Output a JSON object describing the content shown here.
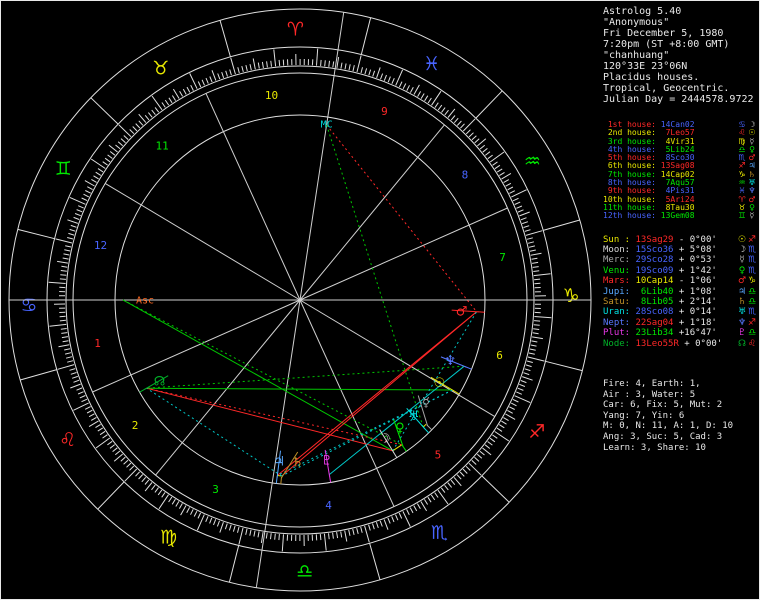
{
  "header": {
    "lines": [
      "Astrolog 5.40",
      "\"Anonymous\"",
      "Fri December 5, 1980",
      "7:20pm (ST +8:00 GMT)",
      "\"chanhuang\"",
      "120°33E 23°06N",
      "Placidus houses.",
      "Tropical, Geocentric.",
      "Julian Day = 2444578.9722"
    ]
  },
  "houses": [
    {
      "label": " 1st house: ",
      "value": "14Can02",
      "lon": 104.033,
      "sign_elem": "water",
      "sign_glyph": "♋",
      "ruler": "moon",
      "ruler_glyph": "☽"
    },
    {
      "label": " 2nd house: ",
      "value": " 7Leo57",
      "lon": 127.95,
      "sign_elem": "fire",
      "sign_glyph": "♌",
      "ruler": "sun",
      "ruler_glyph": "☉"
    },
    {
      "label": " 3rd house: ",
      "value": " 4Vir31",
      "lon": 154.517,
      "sign_elem": "earth",
      "sign_glyph": "♍",
      "ruler": "merc",
      "ruler_glyph": "☿"
    },
    {
      "label": " 4th house: ",
      "value": " 5Lib24",
      "lon": 185.4,
      "sign_elem": "air",
      "sign_glyph": "♎",
      "ruler": "venu",
      "ruler_glyph": "♀"
    },
    {
      "label": " 5th house: ",
      "value": " 8Sco30",
      "lon": 218.5,
      "sign_elem": "water",
      "sign_glyph": "♏",
      "ruler": "mars",
      "ruler_glyph": "♂"
    },
    {
      "label": " 6th house: ",
      "value": "13Sag08",
      "lon": 253.133,
      "sign_elem": "fire",
      "sign_glyph": "♐",
      "ruler": "jupi",
      "ruler_glyph": "♃"
    },
    {
      "label": " 7th house: ",
      "value": "14Cap02",
      "lon": 284.033,
      "sign_elem": "earth",
      "sign_glyph": "♑",
      "ruler": "satu",
      "ruler_glyph": "♄"
    },
    {
      "label": " 8th house: ",
      "value": " 7Aqu57",
      "lon": 307.95,
      "sign_elem": "air",
      "sign_glyph": "♒",
      "ruler": "uran",
      "ruler_glyph": "♅"
    },
    {
      "label": " 9th house: ",
      "value": " 4Pis31",
      "lon": 334.517,
      "sign_elem": "water",
      "sign_glyph": "♓",
      "ruler": "nept",
      "ruler_glyph": "♆"
    },
    {
      "label": "10th house: ",
      "value": " 5Ari24",
      "lon": 5.4,
      "sign_elem": "fire",
      "sign_glyph": "♈",
      "ruler": "mars",
      "ruler_glyph": "♂"
    },
    {
      "label": "11th house: ",
      "value": " 8Tau30",
      "lon": 38.5,
      "sign_elem": "earth",
      "sign_glyph": "♉",
      "ruler": "venu",
      "ruler_glyph": "♀"
    },
    {
      "label": "12th house: ",
      "value": "13Gem08",
      "lon": 73.133,
      "sign_elem": "air",
      "sign_glyph": "♊",
      "ruler": "merc",
      "ruler_glyph": "☿"
    }
  ],
  "planets": [
    {
      "id": "sun",
      "label": "Sun : ",
      "value": "13Sag29",
      "lat": "- 0°00'",
      "lon": 253.483,
      "sign_elem": "fire",
      "glyph": "☉",
      "sign_glyph": "♐"
    },
    {
      "id": "moon",
      "label": "Moon: ",
      "value": "15Sco36",
      "lat": "+ 5°08'",
      "lon": 225.6,
      "sign_elem": "water",
      "glyph": "☽",
      "sign_glyph": "♏"
    },
    {
      "id": "merc",
      "label": "Merc: ",
      "value": "29Sco28",
      "lat": "+ 0°53'",
      "lon": 239.467,
      "sign_elem": "water",
      "glyph": "☿",
      "sign_glyph": "♏"
    },
    {
      "id": "venu",
      "label": "Venu: ",
      "value": "19Sco09",
      "lat": "+ 1°42'",
      "lon": 229.15,
      "sign_elem": "water",
      "glyph": "♀",
      "sign_glyph": "♏"
    },
    {
      "id": "mars",
      "label": "Mars: ",
      "value": "10Cap14",
      "lat": "- 1°06'",
      "lon": 280.233,
      "sign_elem": "earth",
      "glyph": "♂",
      "sign_glyph": "♑"
    },
    {
      "id": "jupi",
      "label": "Jupi: ",
      "value": " 6Lib40",
      "lat": "+ 1°08'",
      "lon": 186.667,
      "sign_elem": "air",
      "glyph": "♃",
      "sign_glyph": "♎"
    },
    {
      "id": "satu",
      "label": "Satu: ",
      "value": " 8Lib05",
      "lat": "+ 2°14'",
      "lon": 188.083,
      "sign_elem": "air",
      "glyph": "♄",
      "sign_glyph": "♎"
    },
    {
      "id": "uran",
      "label": "Uran: ",
      "value": "28Sco08",
      "lat": "+ 0°14'",
      "lon": 238.133,
      "sign_elem": "water",
      "glyph": "♅",
      "sign_glyph": "♏"
    },
    {
      "id": "nept",
      "label": "Nept: ",
      "value": "22Sag04",
      "lat": "+ 1°18'",
      "lon": 262.067,
      "sign_elem": "fire",
      "glyph": "♆",
      "sign_glyph": "♐"
    },
    {
      "id": "plut",
      "label": "Plut: ",
      "value": "23Lib34",
      "lat": "+16°47'",
      "lon": 203.567,
      "sign_elem": "air",
      "glyph": "♇",
      "sign_glyph": "♎"
    },
    {
      "id": "node",
      "label": "Node: ",
      "value": "13Leo55R",
      "lat": "+ 0°00'",
      "lon": 133.917,
      "sign_elem": "fire",
      "glyph": "☊",
      "sign_glyph": "♌"
    }
  ],
  "stats": {
    "lines": [
      "Fire: 4, Earth: 1,",
      "Air : 3, Water: 5",
      "Car: 6, Fix: 5, Mut: 2",
      "Yang: 7, Yin: 6",
      "M: 0, N: 11, A: 1, D: 10",
      "Ang: 3, Suc: 5, Cad: 3",
      "Learn: 3, Share: 10"
    ]
  },
  "wheel": {
    "asc_lon": 104.033,
    "asc_label": "Asc",
    "mc_label": "MC",
    "radii": [
      291,
      253,
      234,
      227,
      185
    ],
    "sign_glyphs": [
      "♈",
      "♉",
      "♊",
      "♋",
      "♌",
      "♍",
      "♎",
      "♏",
      "♐",
      "♑",
      "♒",
      "♓"
    ],
    "sign_names": [
      "Aries",
      "Taurus",
      "Gemini",
      "Cancer",
      "Leo",
      "Virgo",
      "Libra",
      "Scorpio",
      "Sagittarius",
      "Capricorn",
      "Aquarius",
      "Pisces"
    ],
    "house_numbers": [
      "1",
      "2",
      "3",
      "4",
      "5",
      "6",
      "7",
      "8",
      "9",
      "10",
      "11",
      "12"
    ],
    "aspects": [
      {
        "a": "sun",
        "b": "node",
        "type": "trine",
        "dotted": false
      },
      {
        "a": "asc",
        "b": "moon",
        "type": "trine",
        "dotted": false
      },
      {
        "a": "moon",
        "b": "node",
        "type": "square",
        "dotted": false
      },
      {
        "a": "mars",
        "b": "jupi",
        "type": "square",
        "dotted": false
      },
      {
        "a": "mars",
        "b": "satu",
        "type": "square",
        "dotted": false
      },
      {
        "a": "jupi",
        "b": "satu",
        "type": "conjunction",
        "dotted": false
      },
      {
        "a": "merc",
        "b": "uran",
        "type": "conjunction",
        "dotted": false
      },
      {
        "a": "moon",
        "b": "venu",
        "type": "conjunction",
        "dotted": false
      },
      {
        "a": "nept",
        "b": "plut",
        "type": "sextile",
        "dotted": false
      },
      {
        "a": "sun",
        "b": "jupi",
        "type": "sextile",
        "dotted": true
      },
      {
        "a": "sun",
        "b": "satu",
        "type": "sextile",
        "dotted": true
      },
      {
        "a": "venu",
        "b": "node",
        "type": "square",
        "dotted": true
      },
      {
        "a": "satu",
        "b": "node",
        "type": "sextile",
        "dotted": true
      },
      {
        "a": "asc",
        "b": "venu",
        "type": "trine",
        "dotted": true
      },
      {
        "a": "mc",
        "b": "mars",
        "type": "square",
        "dotted": true
      },
      {
        "a": "mc",
        "b": "uran",
        "type": "trine",
        "dotted": true
      },
      {
        "a": "moon",
        "b": "mars",
        "type": "sextile",
        "dotted": true
      },
      {
        "a": "nept",
        "b": "node",
        "type": "trine",
        "dotted": true
      }
    ]
  },
  "colors": {
    "background": "#000000",
    "wheel_line": "#e0e0e0",
    "text": "#e8e8e8",
    "asc_label": "#ff6820",
    "mc_label": "#00d8d8",
    "elements": {
      "fire": "#ff2828",
      "earth": "#e8e800",
      "air": "#00e800",
      "water": "#4864ff"
    },
    "planets": {
      "sun": "#e8e800",
      "moon": "#d8d8d8",
      "merc": "#a8a8a8",
      "venu": "#00e800",
      "mars": "#ff2828",
      "jupi": "#58a8ff",
      "satu": "#c09028",
      "uran": "#00e0e0",
      "nept": "#5878ff",
      "plut": "#e838e8",
      "node": "#00b028"
    },
    "aspects": {
      "conjunction": "#e8e800",
      "sextile": "#00c8c8",
      "square": "#ff2828",
      "trine": "#00c800",
      "opposition": "#4864ff"
    }
  }
}
